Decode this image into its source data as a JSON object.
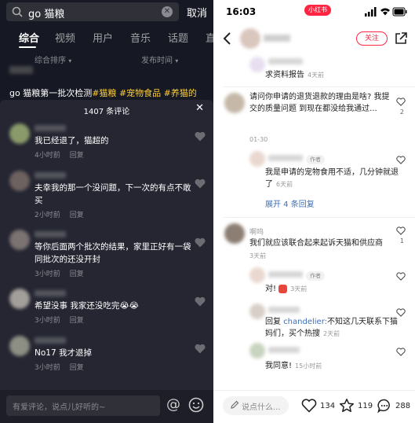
{
  "left": {
    "search": {
      "query": "go 猫粮",
      "cancel": "取消"
    },
    "tabs": [
      "综合",
      "视频",
      "用户",
      "音乐",
      "话题",
      "直"
    ],
    "sort": {
      "order_label": "综合排序",
      "time_label": "发布时间"
    },
    "video_caption": {
      "text": "go 猫粮第一批次检测",
      "tags": [
        "#猫粮",
        "#宠物食品",
        "#养猫的"
      ]
    },
    "comments_header": "1407 条评论",
    "comments": [
      {
        "text": "我已经退了，猫超的",
        "time": "4小时前",
        "reply": "回复"
      },
      {
        "text": "夫幸我的那一个没问题，下一次的有点不敢买",
        "time": "2小时前",
        "reply": "回复"
      },
      {
        "text": "等你后面两个批次的结果，家里正好有一袋同批次的还没开封",
        "time": "3小时前",
        "reply": "回复"
      },
      {
        "text": "希望没事 我家还没吃完😭😭",
        "time": "3小时前",
        "reply": "回复"
      },
      {
        "text": "No17 我才退掉",
        "time": "3小时前",
        "reply": "回复"
      }
    ],
    "input_placeholder": "有爱评论，说点儿好听的~",
    "avatar_colors": [
      "#8a9a6b",
      "#6d625f",
      "#7b7371",
      "#a39f9b",
      "#8d8f84"
    ]
  },
  "right": {
    "status": {
      "time": "16:03",
      "badge": "小红书"
    },
    "follow_label": "关注",
    "thread": [
      {
        "text": "求资料报告",
        "time": "4天前"
      },
      {
        "text": "请问你申请的退货退款的理由是啥? 我提交的质量问题 到现在都没给我通过...",
        "date": "01-30",
        "likes": "2"
      },
      {
        "author_tag": "作者",
        "text": "我是申请的宠物食用不适，几分钟就退了",
        "time": "6天前"
      },
      {
        "expand": "展开 4 条回复"
      },
      {
        "name": "啊呜",
        "text": "我们就应该联合起来起诉天猫和供应商",
        "time": "3天前",
        "likes": "1"
      },
      {
        "author_tag": "作者",
        "text": "对!",
        "time": "3天前"
      },
      {
        "reply_prefix": "回复",
        "mention": "chandelier:",
        "text": "不知这几天联系下猫妈们，买个热搜",
        "time": "2天前"
      },
      {
        "text": "我同意!",
        "time": "15小时前"
      }
    ],
    "bottom": {
      "placeholder": "说点什么...",
      "likes": "134",
      "stars": "119",
      "comments": "288"
    }
  }
}
